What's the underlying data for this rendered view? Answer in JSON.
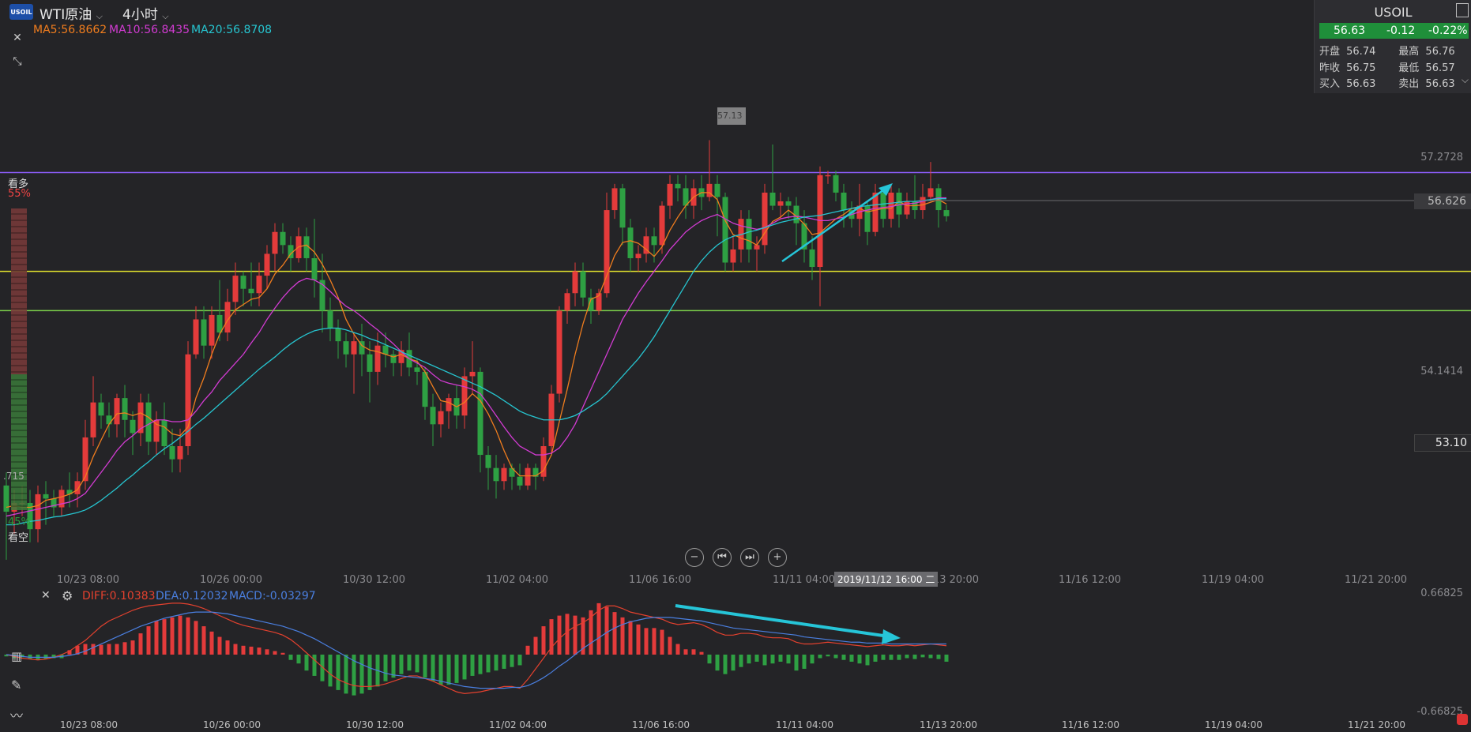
{
  "header": {
    "logo_text": "USOIL",
    "symbol": "WTI原油",
    "period": "4小时",
    "chevron": "⌵"
  },
  "indicators": {
    "ma5": "MA5:56.8662",
    "ma10": "MA10:56.8435",
    "ma20": "MA20:56.8708",
    "ma5_color": "#f07d1e",
    "ma10_color": "#d23bd2",
    "ma20_color": "#26c5d0"
  },
  "quote": {
    "symbol": "USOIL",
    "price": "56.63",
    "change": "-0.12",
    "change_pct": "-0.22%",
    "open_label": "开盘",
    "open": "56.74",
    "high_label": "最高",
    "high": "56.76",
    "prev_label": "昨收",
    "prev": "56.75",
    "low_label": "最低",
    "low": "56.57",
    "bid_label": "买入",
    "bid": "56.63",
    "ask_label": "卖出",
    "ask": "56.63"
  },
  "sentiment": {
    "bull_label": "看多",
    "bull_pct": "55%",
    "bear_label": "看空",
    "bear_pct": "45%",
    "mid_value": ".715"
  },
  "price_axis": {
    "tick_high": "57.2728",
    "tick_mid": "54.1414",
    "current_price": "56.626",
    "marker_low": "53.10",
    "marker_high": "57.13"
  },
  "x_axis": {
    "labels": [
      "10/23 08:00",
      "10/26 00:00",
      "10/30 12:00",
      "11/02 04:00",
      "11/06 16:00",
      "11/11 04:00",
      "11/13 20:00",
      "11/16 12:00",
      "11/19 04:00",
      "11/21 20:00"
    ],
    "cursor_label": "2019/11/12 16:00 二"
  },
  "macd": {
    "diff": "DIFF:0.10383",
    "dea": "DEA:0.12032",
    "macd": "MACD:-0.03297",
    "axis_top": "0.66825",
    "axis_bottom": "-0.66825",
    "diff_color": "#e4412e",
    "dea_color": "#4a7fe0",
    "ylim": [
      -0.66825,
      0.66825
    ]
  },
  "nav": {
    "zoom_out": "−",
    "first": "⏮",
    "last": "⏭",
    "zoom_in": "+"
  },
  "chart_data": {
    "type": "candlestick",
    "title": "WTI原油 4小时",
    "ylim": [
      52.6,
      58.2
    ],
    "levels": [
      {
        "price": 57.13,
        "color": "#8b5cf6"
      },
      {
        "price": 56.0,
        "color": "#e6e62e"
      },
      {
        "price": 55.55,
        "color": "#7ccf4a"
      }
    ],
    "candles": [
      [
        53.55,
        53.25,
        53.7,
        52.7
      ],
      [
        53.25,
        53.35,
        53.5,
        53.0
      ],
      [
        53.35,
        53.35,
        53.55,
        53.2
      ],
      [
        53.35,
        53.05,
        53.5,
        52.9
      ],
      [
        53.05,
        53.45,
        53.55,
        52.9
      ],
      [
        53.45,
        53.4,
        53.6,
        53.1
      ],
      [
        53.4,
        53.3,
        53.5,
        53.2
      ],
      [
        53.3,
        53.5,
        53.55,
        53.2
      ],
      [
        53.5,
        53.45,
        53.7,
        53.3
      ],
      [
        53.45,
        53.6,
        53.7,
        53.3
      ],
      [
        53.6,
        54.1,
        54.3,
        53.5
      ],
      [
        54.1,
        54.5,
        54.8,
        54.0
      ],
      [
        54.5,
        54.35,
        54.6,
        54.2
      ],
      [
        54.35,
        54.25,
        54.5,
        54.1
      ],
      [
        54.25,
        54.55,
        54.6,
        54.1
      ],
      [
        54.55,
        54.3,
        54.7,
        54.1
      ],
      [
        54.3,
        54.15,
        54.4,
        53.9
      ],
      [
        54.15,
        54.5,
        54.6,
        54.0
      ],
      [
        54.5,
        54.05,
        54.6,
        53.9
      ],
      [
        54.05,
        54.3,
        54.4,
        53.9
      ],
      [
        54.3,
        54.0,
        54.5,
        53.9
      ],
      [
        54.0,
        53.85,
        54.2,
        53.7
      ],
      [
        53.85,
        54.0,
        54.2,
        53.7
      ],
      [
        54.0,
        55.05,
        55.2,
        53.9
      ],
      [
        55.05,
        55.45,
        55.6,
        55.0
      ],
      [
        55.45,
        55.15,
        55.6,
        55.0
      ],
      [
        55.15,
        55.5,
        55.6,
        55.0
      ],
      [
        55.5,
        55.3,
        55.9,
        55.2
      ],
      [
        55.3,
        55.65,
        55.8,
        55.2
      ],
      [
        55.65,
        55.95,
        56.1,
        55.5
      ],
      [
        55.95,
        55.8,
        56.0,
        55.6
      ],
      [
        55.8,
        55.75,
        56.1,
        55.6
      ],
      [
        55.75,
        55.95,
        56.1,
        55.6
      ],
      [
        55.95,
        56.2,
        56.3,
        55.8
      ],
      [
        56.2,
        56.45,
        56.55,
        56.0
      ],
      [
        56.45,
        56.3,
        56.55,
        56.2
      ],
      [
        56.3,
        56.15,
        56.4,
        56.0
      ],
      [
        56.15,
        56.4,
        56.5,
        56.1
      ],
      [
        56.4,
        56.15,
        56.5,
        56.0
      ],
      [
        56.15,
        55.9,
        56.6,
        55.7
      ],
      [
        55.9,
        55.55,
        56.2,
        55.3
      ],
      [
        55.55,
        55.35,
        55.7,
        55.2
      ],
      [
        55.35,
        55.2,
        55.45,
        55.0
      ],
      [
        55.2,
        55.05,
        55.3,
        54.9
      ],
      [
        55.05,
        55.2,
        55.3,
        54.6
      ],
      [
        55.2,
        55.05,
        55.4,
        54.8
      ],
      [
        55.05,
        54.85,
        55.2,
        54.5
      ],
      [
        54.85,
        55.15,
        55.3,
        54.7
      ],
      [
        55.15,
        55.05,
        55.3,
        54.9
      ],
      [
        55.05,
        54.95,
        55.1,
        54.8
      ],
      [
        54.95,
        55.1,
        55.2,
        54.8
      ],
      [
        55.1,
        54.9,
        55.3,
        54.8
      ],
      [
        54.9,
        54.85,
        55.0,
        54.7
      ],
      [
        54.85,
        54.45,
        54.9,
        54.3
      ],
      [
        54.45,
        54.25,
        54.6,
        54.0
      ],
      [
        54.25,
        54.4,
        54.5,
        54.1
      ],
      [
        54.4,
        54.55,
        54.6,
        54.2
      ],
      [
        54.55,
        54.35,
        54.7,
        54.2
      ],
      [
        54.35,
        54.8,
        54.9,
        54.2
      ],
      [
        54.8,
        54.85,
        55.2,
        54.6
      ],
      [
        54.85,
        53.9,
        54.9,
        53.7
      ],
      [
        53.9,
        53.75,
        54.0,
        53.5
      ],
      [
        53.75,
        53.6,
        53.9,
        53.4
      ],
      [
        53.6,
        53.75,
        53.8,
        53.5
      ],
      [
        53.75,
        53.65,
        53.8,
        53.5
      ],
      [
        53.65,
        53.55,
        53.8,
        53.5
      ],
      [
        53.55,
        53.75,
        53.8,
        53.5
      ],
      [
        53.75,
        53.65,
        53.8,
        53.5
      ],
      [
        53.65,
        54.0,
        54.1,
        53.6
      ],
      [
        54.0,
        54.6,
        54.7,
        53.9
      ],
      [
        54.6,
        55.55,
        55.6,
        54.5
      ],
      [
        55.55,
        55.75,
        55.8,
        55.4
      ],
      [
        55.75,
        56.0,
        56.1,
        55.6
      ],
      [
        56.0,
        55.7,
        56.1,
        55.6
      ],
      [
        55.7,
        55.55,
        55.8,
        55.4
      ],
      [
        55.55,
        55.75,
        55.8,
        55.5
      ],
      [
        55.75,
        56.7,
        56.9,
        55.7
      ],
      [
        56.7,
        56.95,
        57.0,
        56.6
      ],
      [
        56.95,
        56.5,
        57.0,
        56.3
      ],
      [
        56.5,
        56.15,
        56.6,
        56.0
      ],
      [
        56.15,
        56.2,
        56.3,
        56.0
      ],
      [
        56.2,
        56.4,
        56.5,
        56.1
      ],
      [
        56.4,
        56.3,
        56.5,
        56.1
      ],
      [
        56.3,
        56.75,
        56.8,
        56.2
      ],
      [
        56.75,
        57.0,
        57.1,
        56.6
      ],
      [
        57.0,
        56.95,
        57.1,
        56.8
      ],
      [
        56.95,
        56.75,
        57.1,
        56.6
      ],
      [
        56.75,
        56.95,
        57.05,
        56.6
      ],
      [
        56.95,
        56.85,
        57.1,
        56.7
      ],
      [
        56.85,
        57.0,
        57.5,
        56.8
      ],
      [
        57.0,
        56.85,
        57.1,
        56.4
      ],
      [
        56.85,
        56.1,
        56.9,
        56.0
      ],
      [
        56.1,
        56.25,
        56.4,
        56.0
      ],
      [
        56.25,
        56.6,
        56.7,
        56.1
      ],
      [
        56.6,
        56.25,
        56.7,
        56.1
      ],
      [
        56.25,
        56.3,
        56.4,
        56.0
      ],
      [
        56.3,
        56.9,
        57.0,
        56.2
      ],
      [
        56.9,
        56.75,
        57.45,
        56.7
      ],
      [
        56.75,
        56.8,
        56.9,
        56.6
      ],
      [
        56.8,
        56.75,
        56.85,
        56.6
      ],
      [
        56.75,
        56.55,
        56.85,
        56.3
      ],
      [
        56.55,
        56.25,
        56.7,
        56.1
      ],
      [
        56.25,
        56.05,
        56.4,
        55.9
      ],
      [
        56.05,
        57.1,
        57.2,
        55.6
      ],
      [
        57.1,
        57.1,
        57.15,
        57.0
      ],
      [
        57.1,
        56.9,
        57.15,
        56.8
      ],
      [
        56.9,
        56.7,
        57.0,
        56.5
      ],
      [
        56.7,
        56.6,
        56.8,
        56.5
      ],
      [
        56.6,
        56.75,
        57.0,
        56.4
      ],
      [
        56.75,
        56.45,
        56.8,
        56.3
      ],
      [
        56.45,
        56.9,
        57.0,
        56.4
      ],
      [
        56.9,
        56.6,
        56.95,
        56.5
      ],
      [
        56.6,
        56.9,
        57.0,
        56.5
      ],
      [
        56.9,
        56.65,
        56.95,
        56.5
      ],
      [
        56.65,
        56.8,
        56.9,
        56.6
      ],
      [
        56.8,
        56.7,
        57.1,
        56.6
      ],
      [
        56.7,
        56.85,
        57.0,
        56.6
      ],
      [
        56.85,
        56.95,
        57.25,
        56.8
      ],
      [
        56.95,
        56.7,
        57.0,
        56.5
      ],
      [
        56.7,
        56.63,
        56.76,
        56.57
      ]
    ],
    "ma5": [
      53.3,
      53.32,
      53.3,
      53.3,
      53.32,
      53.38,
      53.4,
      53.42,
      53.45,
      53.5,
      53.65,
      53.88,
      54.07,
      54.25,
      54.37,
      54.38,
      54.35,
      54.38,
      54.33,
      54.25,
      54.22,
      54.14,
      54.12,
      54.22,
      54.55,
      54.78,
      55.05,
      55.28,
      55.44,
      55.56,
      55.62,
      55.68,
      55.7,
      55.8,
      55.97,
      56.07,
      56.2,
      56.28,
      56.3,
      56.22,
      56.08,
      55.9,
      55.7,
      55.45,
      55.28,
      55.15,
      55.1,
      55.08,
      55.05,
      55.02,
      55.05,
      55.0,
      54.97,
      54.85,
      54.68,
      54.52,
      54.5,
      54.45,
      54.5,
      54.6,
      54.52,
      54.37,
      54.18,
      53.95,
      53.75,
      53.66,
      53.66,
      53.66,
      53.72,
      53.9,
      54.28,
      54.65,
      55.05,
      55.4,
      55.68,
      55.72,
      55.95,
      56.18,
      56.33,
      56.35,
      56.32,
      56.25,
      56.17,
      56.28,
      56.47,
      56.62,
      56.75,
      56.85,
      56.9,
      56.9,
      56.82,
      56.58,
      56.42,
      56.38,
      56.35,
      56.3,
      56.44,
      56.57,
      56.62,
      56.7,
      56.63,
      56.54,
      56.42,
      56.44,
      56.52,
      56.6,
      56.65,
      56.72,
      56.72,
      56.68,
      56.7,
      56.72,
      56.72,
      56.8,
      56.75,
      56.75,
      56.76,
      56.79,
      56.82,
      56.77
    ],
    "ma10": [
      53.2,
      53.22,
      53.24,
      53.26,
      53.28,
      53.3,
      53.32,
      53.34,
      53.36,
      53.4,
      53.46,
      53.58,
      53.7,
      53.82,
      53.95,
      54.05,
      54.12,
      54.2,
      54.25,
      54.3,
      54.3,
      54.28,
      54.28,
      54.3,
      54.4,
      54.52,
      54.62,
      54.75,
      54.85,
      54.95,
      55.05,
      55.18,
      55.3,
      55.45,
      55.58,
      55.7,
      55.8,
      55.88,
      55.92,
      55.9,
      55.85,
      55.77,
      55.68,
      55.6,
      55.55,
      55.48,
      55.4,
      55.33,
      55.25,
      55.17,
      55.08,
      55.0,
      54.95,
      54.9,
      54.82,
      54.75,
      54.72,
      54.7,
      54.68,
      54.65,
      54.6,
      54.48,
      54.35,
      54.22,
      54.1,
      54.0,
      53.95,
      53.9,
      53.9,
      53.92,
      53.98,
      54.1,
      54.25,
      54.45,
      54.65,
      54.85,
      55.05,
      55.25,
      55.45,
      55.6,
      55.75,
      55.88,
      56.0,
      56.12,
      56.25,
      56.35,
      56.45,
      56.52,
      56.58,
      56.62,
      56.65,
      56.6,
      56.55,
      56.52,
      56.5,
      56.48,
      56.5,
      56.55,
      56.6,
      56.62,
      56.63,
      56.62,
      56.6,
      56.58,
      56.58,
      56.6,
      56.62,
      56.65,
      56.68,
      56.7,
      56.72,
      56.73,
      56.74,
      56.76,
      56.77,
      56.78,
      56.8,
      56.82,
      56.84,
      56.84
    ],
    "ma20": [
      53.1,
      53.1,
      53.12,
      53.14,
      53.15,
      53.17,
      53.19,
      53.2,
      53.22,
      53.24,
      53.27,
      53.32,
      53.38,
      53.45,
      53.52,
      53.6,
      53.67,
      53.75,
      53.82,
      53.9,
      53.97,
      54.03,
      54.1,
      54.17,
      54.25,
      54.32,
      54.4,
      54.48,
      54.56,
      54.64,
      54.72,
      54.8,
      54.88,
      54.95,
      55.02,
      55.1,
      55.17,
      55.23,
      55.28,
      55.32,
      55.34,
      55.35,
      55.35,
      55.33,
      55.3,
      55.27,
      55.23,
      55.2,
      55.16,
      55.12,
      55.08,
      55.04,
      55.0,
      54.96,
      54.92,
      54.88,
      54.84,
      54.8,
      54.76,
      54.72,
      54.68,
      54.63,
      54.58,
      54.52,
      54.46,
      54.4,
      54.36,
      54.33,
      54.3,
      54.3,
      54.3,
      54.32,
      54.35,
      54.4,
      54.46,
      54.52,
      54.6,
      54.7,
      54.8,
      54.9,
      55.0,
      55.12,
      55.25,
      55.4,
      55.55,
      55.7,
      55.85,
      56.0,
      56.12,
      56.22,
      56.3,
      56.36,
      56.4,
      56.42,
      56.45,
      56.47,
      56.5,
      56.53,
      56.56,
      56.58,
      56.6,
      56.62,
      56.63,
      56.64,
      56.66,
      56.68,
      56.7,
      56.72,
      56.74,
      56.75,
      56.76,
      56.77,
      56.78,
      56.79,
      56.8,
      56.8,
      56.81,
      56.82,
      56.83,
      56.83
    ],
    "macd_hist": [
      -0.02,
      -0.04,
      -0.03,
      -0.05,
      -0.06,
      -0.05,
      -0.04,
      -0.04,
      0.05,
      0.1,
      0.12,
      0.12,
      0.11,
      0.12,
      0.12,
      0.14,
      0.16,
      0.24,
      0.32,
      0.38,
      0.4,
      0.42,
      0.44,
      0.42,
      0.38,
      0.32,
      0.26,
      0.2,
      0.16,
      0.12,
      0.1,
      0.09,
      0.08,
      0.06,
      0.04,
      0.02,
      -0.06,
      -0.1,
      -0.18,
      -0.24,
      -0.3,
      -0.36,
      -0.4,
      -0.44,
      -0.46,
      -0.44,
      -0.4,
      -0.36,
      -0.3,
      -0.26,
      -0.22,
      -0.18,
      -0.2,
      -0.26,
      -0.3,
      -0.34,
      -0.34,
      -0.32,
      -0.28,
      -0.24,
      -0.22,
      -0.2,
      -0.18,
      -0.16,
      -0.14,
      -0.12,
      0.1,
      0.2,
      0.32,
      0.4,
      0.44,
      0.46,
      0.44,
      0.42,
      0.5,
      0.58,
      0.54,
      0.48,
      0.42,
      0.38,
      0.34,
      0.3,
      0.3,
      0.28,
      0.2,
      0.12,
      0.06,
      0.06,
      0.03,
      -0.1,
      -0.18,
      -0.22,
      -0.18,
      -0.14,
      -0.1,
      -0.08,
      -0.12,
      -0.1,
      -0.08,
      -0.1,
      -0.18,
      -0.16,
      -0.1,
      -0.04,
      -0.02,
      -0.04,
      -0.06,
      -0.08,
      -0.1,
      -0.12,
      -0.08,
      -0.06,
      -0.06,
      -0.06,
      -0.04,
      -0.05,
      -0.03,
      -0.04,
      -0.05,
      -0.08
    ],
    "macd_diff": [
      0.0,
      -0.02,
      -0.04,
      -0.05,
      -0.06,
      -0.05,
      -0.03,
      0.0,
      0.04,
      0.1,
      0.16,
      0.24,
      0.32,
      0.38,
      0.42,
      0.46,
      0.5,
      0.53,
      0.55,
      0.56,
      0.57,
      0.58,
      0.58,
      0.57,
      0.55,
      0.52,
      0.48,
      0.44,
      0.4,
      0.36,
      0.33,
      0.31,
      0.29,
      0.27,
      0.25,
      0.22,
      0.17,
      0.1,
      0.02,
      -0.06,
      -0.14,
      -0.22,
      -0.28,
      -0.32,
      -0.35,
      -0.36,
      -0.36,
      -0.35,
      -0.33,
      -0.3,
      -0.27,
      -0.24,
      -0.24,
      -0.27,
      -0.3,
      -0.34,
      -0.38,
      -0.42,
      -0.44,
      -0.43,
      -0.42,
      -0.4,
      -0.38,
      -0.36,
      -0.36,
      -0.38,
      -0.28,
      -0.16,
      -0.04,
      0.08,
      0.18,
      0.26,
      0.32,
      0.36,
      0.42,
      0.5,
      0.55,
      0.55,
      0.52,
      0.48,
      0.46,
      0.44,
      0.42,
      0.4,
      0.36,
      0.34,
      0.35,
      0.36,
      0.34,
      0.3,
      0.25,
      0.22,
      0.22,
      0.24,
      0.24,
      0.23,
      0.2,
      0.19,
      0.19,
      0.18,
      0.14,
      0.12,
      0.12,
      0.13,
      0.14,
      0.13,
      0.12,
      0.11,
      0.1,
      0.09,
      0.1,
      0.11,
      0.1,
      0.1,
      0.11,
      0.1,
      0.11,
      0.12,
      0.11,
      0.1
    ],
    "macd_dea": [
      0.0,
      -0.01,
      -0.02,
      -0.03,
      -0.03,
      -0.03,
      -0.03,
      -0.02,
      -0.01,
      0.01,
      0.04,
      0.08,
      0.12,
      0.16,
      0.2,
      0.24,
      0.28,
      0.32,
      0.35,
      0.38,
      0.41,
      0.43,
      0.45,
      0.47,
      0.48,
      0.48,
      0.48,
      0.47,
      0.46,
      0.44,
      0.42,
      0.4,
      0.38,
      0.36,
      0.34,
      0.32,
      0.29,
      0.26,
      0.22,
      0.18,
      0.13,
      0.08,
      0.03,
      -0.02,
      -0.07,
      -0.11,
      -0.15,
      -0.18,
      -0.21,
      -0.23,
      -0.24,
      -0.25,
      -0.26,
      -0.27,
      -0.28,
      -0.3,
      -0.32,
      -0.34,
      -0.36,
      -0.37,
      -0.38,
      -0.38,
      -0.38,
      -0.38,
      -0.37,
      -0.37,
      -0.35,
      -0.31,
      -0.26,
      -0.2,
      -0.13,
      -0.07,
      0.0,
      0.07,
      0.13,
      0.19,
      0.25,
      0.3,
      0.34,
      0.37,
      0.39,
      0.41,
      0.42,
      0.42,
      0.42,
      0.41,
      0.4,
      0.39,
      0.38,
      0.36,
      0.34,
      0.32,
      0.3,
      0.29,
      0.28,
      0.27,
      0.26,
      0.25,
      0.24,
      0.23,
      0.22,
      0.2,
      0.19,
      0.18,
      0.17,
      0.16,
      0.15,
      0.14,
      0.14,
      0.13,
      0.13,
      0.13,
      0.12,
      0.12,
      0.12,
      0.12,
      0.12,
      0.12,
      0.12,
      0.12
    ]
  }
}
